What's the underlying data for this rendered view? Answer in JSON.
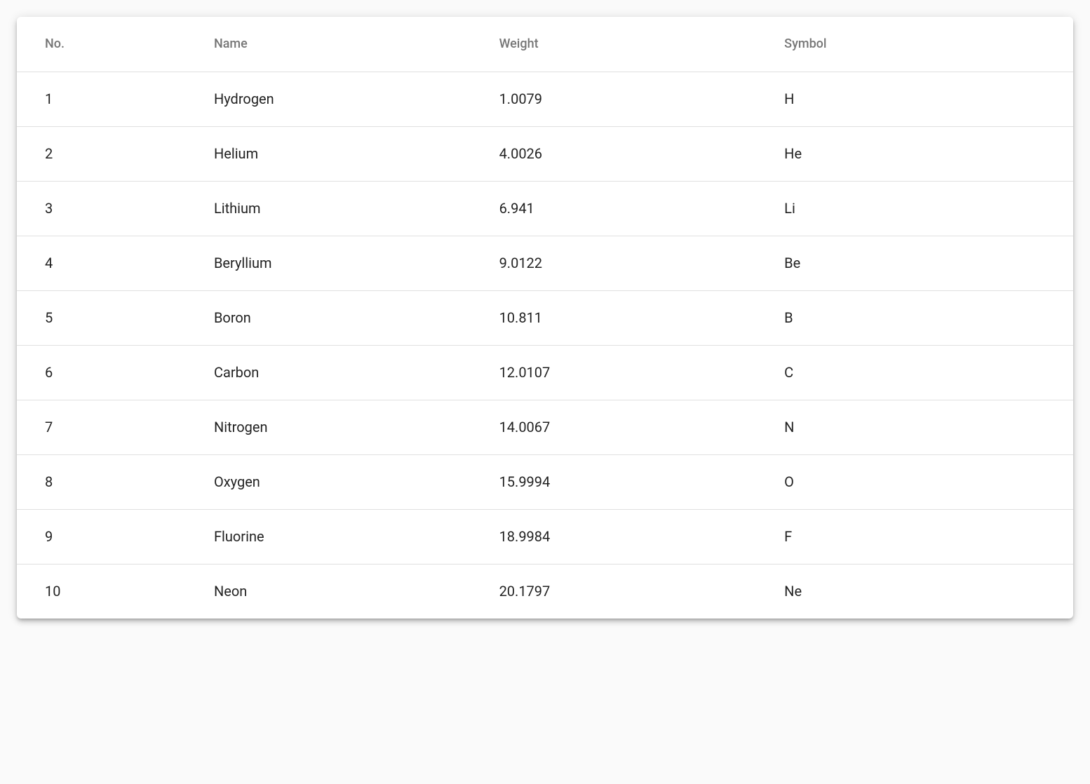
{
  "table": {
    "columns": {
      "no": "No.",
      "name": "Name",
      "weight": "Weight",
      "symbol": "Symbol"
    },
    "rows": [
      {
        "no": "1",
        "name": "Hydrogen",
        "weight": "1.0079",
        "symbol": "H"
      },
      {
        "no": "2",
        "name": "Helium",
        "weight": "4.0026",
        "symbol": "He"
      },
      {
        "no": "3",
        "name": "Lithium",
        "weight": "6.941",
        "symbol": "Li"
      },
      {
        "no": "4",
        "name": "Beryllium",
        "weight": "9.0122",
        "symbol": "Be"
      },
      {
        "no": "5",
        "name": "Boron",
        "weight": "10.811",
        "symbol": "B"
      },
      {
        "no": "6",
        "name": "Carbon",
        "weight": "12.0107",
        "symbol": "C"
      },
      {
        "no": "7",
        "name": "Nitrogen",
        "weight": "14.0067",
        "symbol": "N"
      },
      {
        "no": "8",
        "name": "Oxygen",
        "weight": "15.9994",
        "symbol": "O"
      },
      {
        "no": "9",
        "name": "Fluorine",
        "weight": "18.9984",
        "symbol": "F"
      },
      {
        "no": "10",
        "name": "Neon",
        "weight": "20.1797",
        "symbol": "Ne"
      }
    ]
  }
}
